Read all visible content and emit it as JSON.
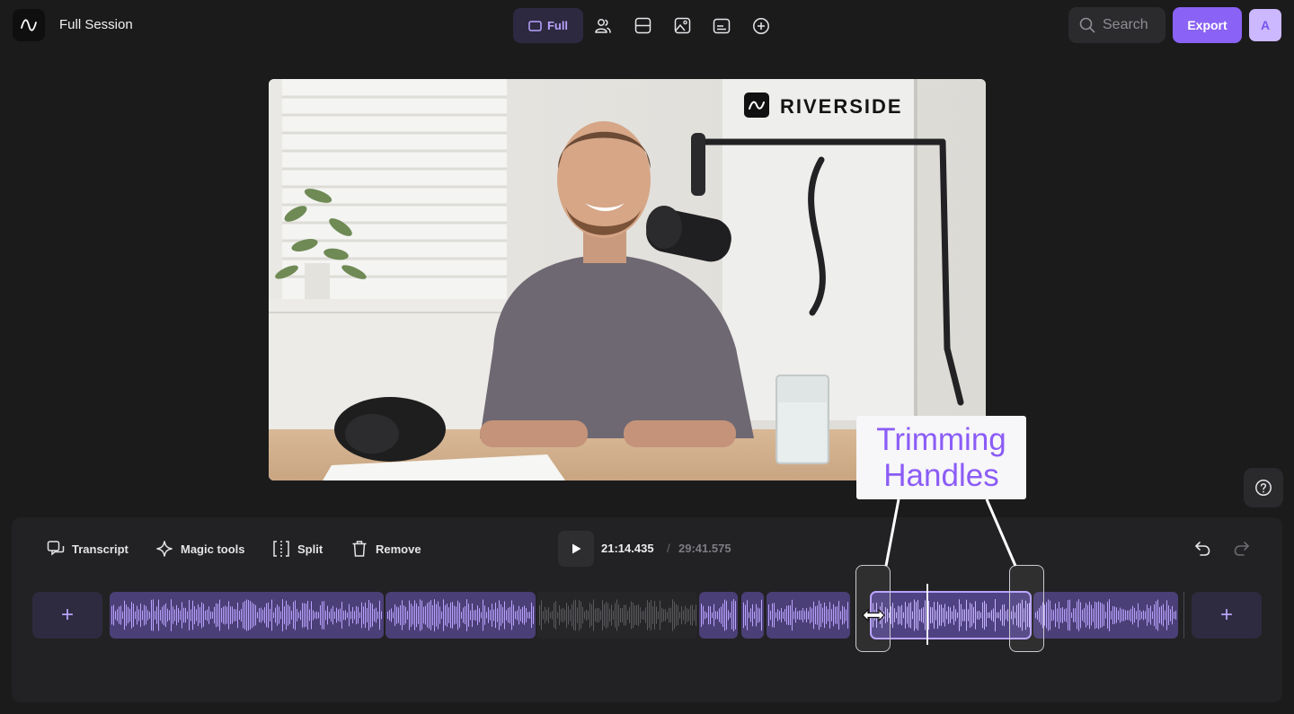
{
  "header": {
    "title": "Full Session",
    "logo_icon": "waveform-logo-icon",
    "view_tabs": [
      {
        "label": "Full",
        "icon": "frame-icon",
        "active": true
      },
      {
        "icon": "people-icon"
      },
      {
        "icon": "split-layout-icon"
      },
      {
        "icon": "image-icon"
      },
      {
        "icon": "captions-icon"
      },
      {
        "icon": "add-circle-icon"
      }
    ],
    "search_placeholder": "Search",
    "export_label": "Export",
    "avatar_initial": "A"
  },
  "video": {
    "watermark": "RIVERSIDE"
  },
  "callout": {
    "line1": "Trimming",
    "line2": "Handles"
  },
  "toolbar": {
    "transcript_label": "Transcript",
    "magic_label": "Magic tools",
    "split_label": "Split",
    "remove_label": "Remove",
    "current_time": "21:14.435",
    "separator": "/",
    "total_time": "29:41.575"
  },
  "timeline": {
    "add_label": "+"
  },
  "colors": {
    "accent": "#8a62f5",
    "accent_light": "#b9a4ff",
    "background": "#1b1b1c",
    "panel": "#222224"
  }
}
